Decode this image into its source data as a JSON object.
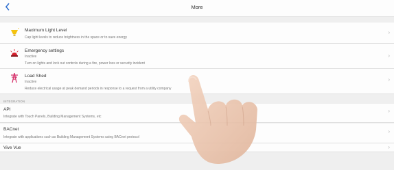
{
  "header": {
    "title": "More",
    "back_icon": "chevron-left-icon"
  },
  "items": [
    {
      "title": "Maximum Light Level",
      "description": "Cap light levels to reduce brightness in the space or to save energy",
      "icon": "light-bulb-icon"
    },
    {
      "title": "Emergency settings",
      "status": "Inactive",
      "description": "Turn on lights and lock out controls during a fire, power loss or security incident",
      "icon": "emergency-light-icon"
    },
    {
      "title": "Load Shed",
      "status": "Inactive",
      "description": "Reduce electrical usage at peak demand periods in response to a request from a utility company",
      "icon": "power-tower-icon"
    }
  ],
  "integration": {
    "section_label": "INTEGRATION",
    "items": [
      {
        "title": "API",
        "description": "Integrate with Touch Panels, Building Management Systems, etc"
      },
      {
        "title": "BACnet",
        "description": "Integrate with applications such as Building Management Systems using BACnet protocol"
      },
      {
        "title": "Vive Vue"
      }
    ]
  },
  "colors": {
    "accent": "#2f6fd0",
    "alert_red": "#d61f2c",
    "bulb_yellow": "#f4c20d",
    "tower_pink": "#d6336c"
  }
}
